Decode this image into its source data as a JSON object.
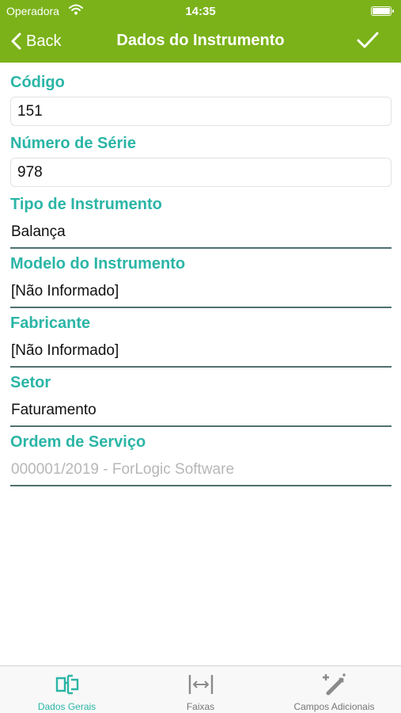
{
  "status_bar": {
    "carrier": "Operadora",
    "time": "14:35"
  },
  "nav": {
    "back_label": "Back",
    "title": "Dados do Instrumento"
  },
  "form": {
    "codigo": {
      "label": "Código",
      "value": "151"
    },
    "numero_serie": {
      "label": "Número de Série",
      "value": "978"
    },
    "tipo_instrumento": {
      "label": "Tipo de Instrumento",
      "value": "Balança"
    },
    "modelo_instrumento": {
      "label": "Modelo do Instrumento",
      "value": "[Não Informado]"
    },
    "fabricante": {
      "label": "Fabricante",
      "value": "[Não Informado]"
    },
    "setor": {
      "label": "Setor",
      "value": "Faturamento"
    },
    "ordem_servico": {
      "label": "Ordem de Serviço",
      "value": "000001/2019 - ForLogic Software"
    }
  },
  "tabs": [
    {
      "label": "Dados Gerais",
      "icon": "instrument-icon",
      "active": true
    },
    {
      "label": "Faixas",
      "icon": "range-icon",
      "active": false
    },
    {
      "label": "Campos Adicionais",
      "icon": "magic-wand-icon",
      "active": false
    }
  ],
  "colors": {
    "header": "#7bb21a",
    "accent": "#2bb5a6",
    "underline": "#4f7070",
    "disabled": "#b7b7b7"
  }
}
